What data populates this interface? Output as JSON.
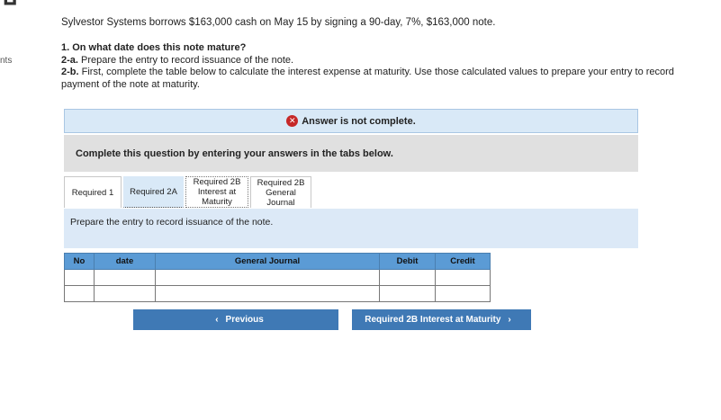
{
  "corner_glyph": "ป",
  "side_label": "nts",
  "intro": "Sylvestor Systems borrows $163,000 cash on May 15 by signing a 90-day, 7%, $163,000 note.",
  "questions": {
    "q1": "1. On what date does this note mature?",
    "q2a_label": "2-a.",
    "q2a_text": " Prepare the entry to record issuance of the note.",
    "q2b_label": "2-b.",
    "q2b_text": " First, complete the table below to calculate the interest expense at maturity. Use those calculated values to prepare your entry to record payment of the note at maturity."
  },
  "status": {
    "icon": "error-x-icon",
    "text": "Answer is not complete."
  },
  "instruction": "Complete this question by entering your answers in the tabs below.",
  "tabs": [
    {
      "line1": "Required 1",
      "line2": "",
      "line3": ""
    },
    {
      "line1": "Required 2A",
      "line2": "",
      "line3": ""
    },
    {
      "line1": "Required 2B",
      "line2": "Interest at",
      "line3": "Maturity"
    },
    {
      "line1": "Required 2B",
      "line2": "General",
      "line3": "Journal"
    }
  ],
  "panel_text": "Prepare the entry to record issuance of the note.",
  "table": {
    "headers": [
      "No",
      "date",
      "General Journal",
      "Debit",
      "Credit"
    ],
    "rows": [
      [
        "",
        "",
        "",
        "",
        ""
      ],
      [
        "",
        "",
        "",
        "",
        ""
      ]
    ]
  },
  "buttons": {
    "prev_label": "Previous",
    "next_label": "Required 2B Interest at Maturity"
  },
  "colors": {
    "accent": "#3f79b5",
    "header": "#5b9bd5",
    "panel": "#dce9f7",
    "error": "#c62828"
  }
}
